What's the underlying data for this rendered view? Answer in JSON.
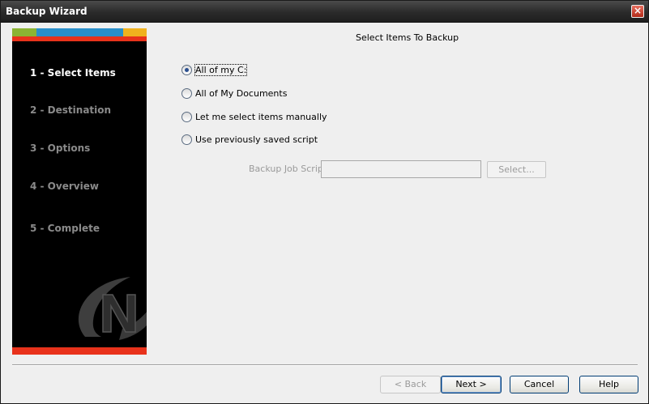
{
  "window": {
    "title": "Backup Wizard",
    "close_glyph": "×"
  },
  "sidebar": {
    "steps": [
      {
        "label": "1 - Select Items",
        "active": true
      },
      {
        "label": "2 - Destination",
        "active": false
      },
      {
        "label": "3 - Options",
        "active": false
      },
      {
        "label": "4 - Overview",
        "active": false
      },
      {
        "label": "5 - Complete",
        "active": false
      }
    ],
    "stripe_colors": [
      "#8bb433",
      "#2a8fca",
      "#f0b21e",
      "#e8321b"
    ],
    "logo_icon": "n-logo-icon"
  },
  "main": {
    "heading": "Select Items To Backup",
    "options": [
      {
        "label": "All of my C:",
        "selected": true
      },
      {
        "label": "All of My Documents",
        "selected": false
      },
      {
        "label": "Let me select items manually",
        "selected": false
      },
      {
        "label": "Use previously saved script",
        "selected": false
      }
    ],
    "script_label": "Backup Job Script",
    "script_value": "",
    "select_button": "Select..."
  },
  "footer": {
    "back": "< Back",
    "next": "Next >",
    "cancel": "Cancel",
    "help": "Help"
  }
}
